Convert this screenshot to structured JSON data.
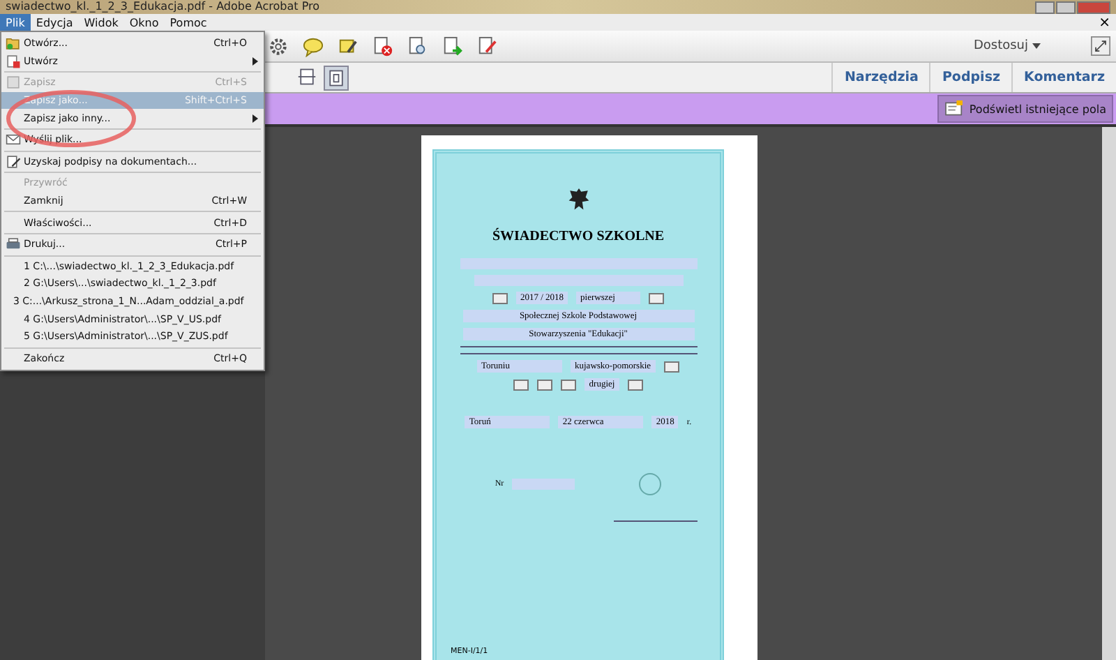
{
  "window": {
    "title": "swiadectwo_kl._1_2_3_Edukacja.pdf - Adobe Acrobat Pro",
    "close_doc": "×"
  },
  "menubar": [
    {
      "label": "Plik",
      "selected": true
    },
    {
      "label": "Edycja",
      "selected": false
    },
    {
      "label": "Widok",
      "selected": false
    },
    {
      "label": "Okno",
      "selected": false
    },
    {
      "label": "Pomoc",
      "selected": false
    }
  ],
  "menu": [
    {
      "kind": "item",
      "label": "Otwórz...",
      "shortcut": "Ctrl+O",
      "disabled": false,
      "selected": false,
      "submenu": false
    },
    {
      "kind": "item",
      "label": "Utwórz",
      "disabled": false,
      "selected": false,
      "submenu": true
    },
    {
      "kind": "separator"
    },
    {
      "kind": "item",
      "label": "Zapisz",
      "shortcut": "Ctrl+S",
      "disabled": true,
      "selected": false,
      "submenu": false
    },
    {
      "kind": "item",
      "label": "Zapisz jako...",
      "shortcut": "Shift+Ctrl+S",
      "disabled": false,
      "selected": true,
      "submenu": false
    },
    {
      "kind": "item",
      "label": "Zapisz jako inny...",
      "disabled": false,
      "selected": false,
      "submenu": true
    },
    {
      "kind": "separator"
    },
    {
      "kind": "item",
      "label": "Wyślij plik...",
      "disabled": false,
      "selected": false,
      "submenu": false
    },
    {
      "kind": "separator"
    },
    {
      "kind": "item",
      "label": "Uzyskaj podpisy na dokumentach...",
      "disabled": false,
      "selected": false,
      "submenu": false
    },
    {
      "kind": "separator"
    },
    {
      "kind": "item",
      "label": "Przywróć",
      "disabled": true,
      "selected": false,
      "submenu": false
    },
    {
      "kind": "item",
      "label": "Zamknij",
      "shortcut": "Ctrl+W",
      "disabled": false,
      "selected": false,
      "submenu": false
    },
    {
      "kind": "separator"
    },
    {
      "kind": "item",
      "label": "Właściwości...",
      "shortcut": "Ctrl+D",
      "disabled": false,
      "selected": false,
      "submenu": false
    },
    {
      "kind": "separator"
    },
    {
      "kind": "item",
      "label": "Drukuj...",
      "shortcut": "Ctrl+P",
      "disabled": false,
      "selected": false,
      "submenu": false
    },
    {
      "kind": "separator"
    },
    {
      "kind": "item",
      "label": "1 C:\\...\\swiadectwo_kl._1_2_3_Edukacja.pdf",
      "disabled": false,
      "selected": false,
      "submenu": false
    },
    {
      "kind": "item",
      "label": "2 G:\\Users\\...\\swiadectwo_kl._1_2_3.pdf",
      "disabled": false,
      "selected": false,
      "submenu": false
    },
    {
      "kind": "item",
      "label": "3 C:...\\Arkusz_strona_1_N...Adam_oddzial_a.pdf",
      "disabled": false,
      "selected": false,
      "submenu": false
    },
    {
      "kind": "item",
      "label": "4 G:\\Users\\Administrator\\...\\SP_V_US.pdf",
      "disabled": false,
      "selected": false,
      "submenu": false
    },
    {
      "kind": "item",
      "label": "5 G:\\Users\\Administrator\\...\\SP_V_ZUS.pdf",
      "disabled": false,
      "selected": false,
      "submenu": false
    },
    {
      "kind": "separator"
    },
    {
      "kind": "item",
      "label": "Zakończ",
      "shortcut": "Ctrl+Q",
      "disabled": false,
      "selected": false,
      "submenu": false
    }
  ],
  "toolbar": {
    "zoom_mode": "Dostosuj"
  },
  "panels": [
    {
      "label": "Narzędzia"
    },
    {
      "label": "Podpisz"
    },
    {
      "label": "Komentarz"
    }
  ],
  "form_bar": {
    "button": "Podświetl istniejące pola"
  },
  "certificate": {
    "title": "ŚWIADECTWO SZKOLNE",
    "school_year": "2017 / 2018",
    "grade": "pierwszej",
    "school": "Społecznej Szkole Podstawowej",
    "association": "Stowarzyszenia \"Edukacji\"",
    "city": "Toruniu",
    "province": "kujawsko-pomorskie",
    "next_grade": "drugiej",
    "place": "Toruń",
    "date": "22 czerwca",
    "year": "2018",
    "year_suffix": "r.",
    "number_label": "Nr",
    "code": "MEN-I/1/1"
  }
}
